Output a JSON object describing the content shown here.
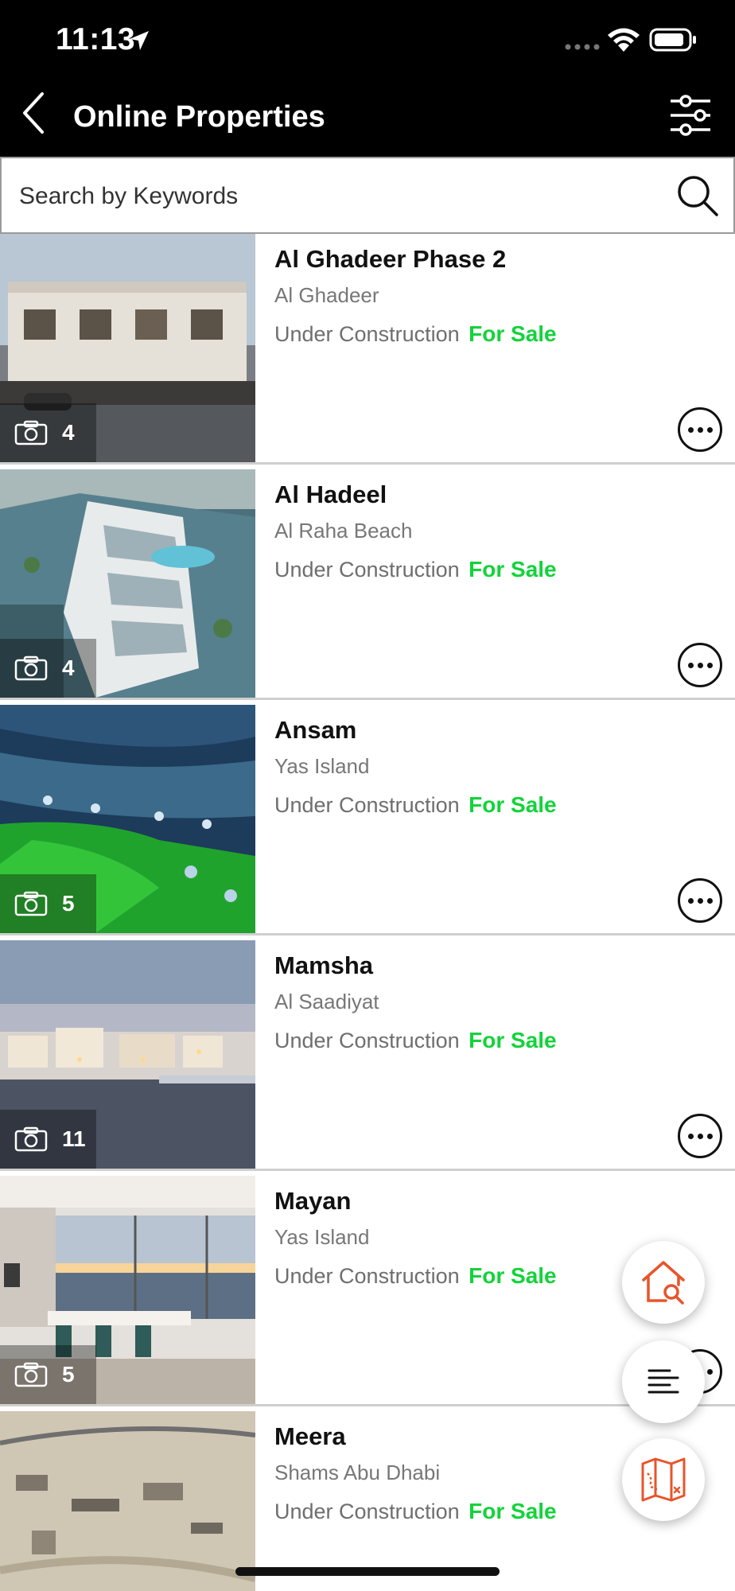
{
  "status_bar": {
    "time": "11:13"
  },
  "header": {
    "title": "Online Properties"
  },
  "search": {
    "placeholder": "Search by Keywords"
  },
  "colors": {
    "header_bg": "#000000",
    "for_sale": "#13d33a",
    "fab_accent": "#e8542a"
  },
  "icons": {
    "back": "chevron-left-icon",
    "filter": "sliders-icon",
    "search": "search-icon",
    "camera": "camera-icon",
    "more": "more-horizontal-icon",
    "fab_home": "home-search-icon",
    "fab_list": "list-icon",
    "fab_map": "map-icon"
  },
  "properties": [
    {
      "name": "Al Ghadeer Phase 2",
      "location": "Al Ghadeer",
      "status": "Under Construction",
      "sale": "For Sale",
      "photos": "4"
    },
    {
      "name": "Al Hadeel",
      "location": "Al Raha Beach",
      "status": "Under Construction",
      "sale": "For Sale",
      "photos": "4"
    },
    {
      "name": "Ansam",
      "location": "Yas Island",
      "status": "Under Construction",
      "sale": "For Sale",
      "photos": "5"
    },
    {
      "name": "Mamsha",
      "location": "Al Saadiyat",
      "status": "Under Construction",
      "sale": "For Sale",
      "photos": "11"
    },
    {
      "name": "Mayan",
      "location": "Yas Island",
      "status": "Under Construction",
      "sale": "For Sale",
      "photos": "5"
    },
    {
      "name": "Meera",
      "location": "Shams Abu Dhabi",
      "status": "Under Construction",
      "sale": "For Sale",
      "photos": ""
    }
  ]
}
